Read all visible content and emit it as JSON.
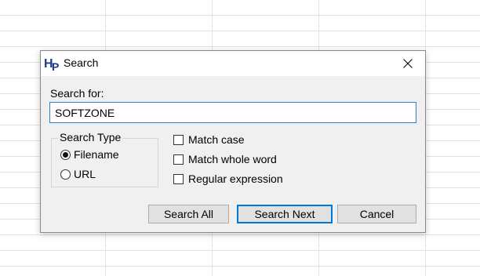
{
  "dialog": {
    "title": "Search",
    "search_label": "Search for:",
    "search_value": "SOFTZONE",
    "search_type": {
      "legend": "Search Type",
      "options": [
        "Filename",
        "URL"
      ],
      "selected": "Filename"
    },
    "checkboxes": {
      "match_case": "Match case",
      "match_whole_word": "Match whole word",
      "regular_expression": "Regular expression"
    },
    "buttons": {
      "search_all": "Search All",
      "search_next": "Search Next",
      "cancel": "Cancel"
    }
  },
  "colors": {
    "accent": "#0078d7",
    "input_border": "#2f7fd0",
    "icon_blue": "#1f3a8c",
    "dialog_bg": "#f0f0f0"
  },
  "icons": {
    "app": "hp-app-icon",
    "close": "close-icon"
  }
}
